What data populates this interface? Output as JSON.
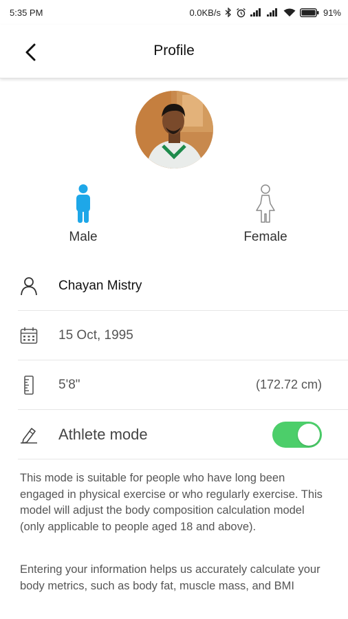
{
  "status": {
    "time": "5:35 PM",
    "network_speed": "0.0KB/s",
    "battery": "91%",
    "icons": [
      "bluetooth-icon",
      "alarm-icon",
      "signal-icon",
      "signal-icon",
      "wifi-icon",
      "battery-icon"
    ]
  },
  "header": {
    "title": "Profile",
    "back_icon": "back-arrow-icon"
  },
  "gender": {
    "male_label": "Male",
    "female_label": "Female",
    "selected": "Male",
    "male_color": "#1ea7e8",
    "female_color": "#9a9a9a"
  },
  "profile": {
    "name": "Chayan Mistry",
    "birthdate": "15 Oct, 1995",
    "height": "5'8\"",
    "height_metric": "(172.72 cm)",
    "athlete_label": "Athlete mode",
    "athlete_enabled": true
  },
  "description": {
    "athlete": "This mode is suitable for people who have long been engaged in physical exercise or who regularly exercise. This model will adjust the body composition calculation model (only applicable to people aged 18 and above).",
    "info": "Entering your information helps us accurately calculate your body metrics, such as body fat, muscle mass, and BMI"
  },
  "colors": {
    "toggle_on": "#4cce6a",
    "accent": "#1ea7e8"
  }
}
